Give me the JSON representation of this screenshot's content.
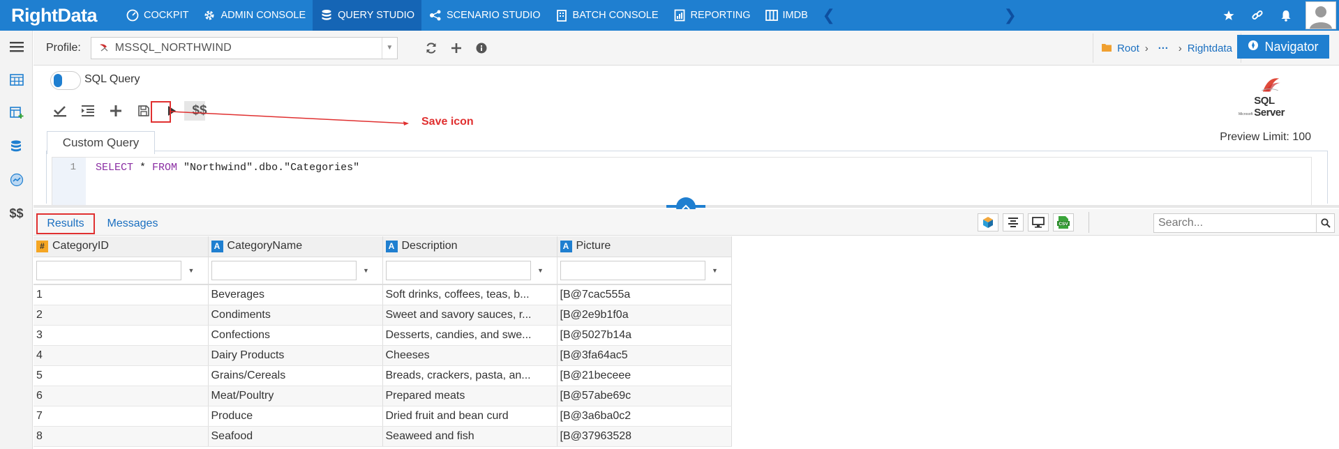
{
  "topbar": {
    "logo": "RightData",
    "nav": [
      {
        "label": "COCKPIT",
        "icon": "cockpit-gauge-icon"
      },
      {
        "label": "ADMIN CONSOLE",
        "icon": "gear-icon"
      },
      {
        "label": "QUERY STUDIO",
        "icon": "database-icon",
        "active": true
      },
      {
        "label": "SCENARIO STUDIO",
        "icon": "network-icon"
      },
      {
        "label": "BATCH CONSOLE",
        "icon": "building-icon"
      },
      {
        "label": "REPORTING",
        "icon": "report-chart-icon"
      },
      {
        "label": "IMDB",
        "icon": "columns-icon"
      }
    ],
    "right_icons": [
      "star-icon",
      "link-icon",
      "bell-icon",
      "user-avatar"
    ]
  },
  "sidebar": {
    "icons": [
      "menu-icon",
      "calendar-grid-icon",
      "table-add-icon",
      "database-connect-icon",
      "chart-circle-icon",
      "dollar-icon"
    ]
  },
  "profile": {
    "label": "Profile:",
    "value": "MSSQL_NORTHWIND",
    "buttons": [
      "refresh-icon",
      "add-icon",
      "info-icon"
    ]
  },
  "breadcrumb": {
    "root": "Root",
    "ellipsis": "···",
    "current": "Rightdata"
  },
  "navigator_label": "Navigator",
  "sql_toggle_label": "SQL Query",
  "toolbar": {
    "validate": "check-icon",
    "format": "indent-icon",
    "add": "plus-icon",
    "save": "save-icon",
    "run": "play-icon",
    "params": "$$"
  },
  "annotation": "Save icon",
  "engine_logo_text": "SQL Server",
  "engine_logo_small": "Microsoft",
  "preview_limit": "Preview Limit: 100",
  "query_tab": "Custom Query",
  "editor": {
    "line_no": "1",
    "kw1": "SELECT",
    "mid": " * ",
    "kw2": "FROM",
    "rest": " \"Northwind\".dbo.\"Categories\""
  },
  "results_tabs": {
    "results": "Results",
    "messages": "Messages"
  },
  "search_placeholder": "Search...",
  "grid": {
    "columns": [
      {
        "name": "CategoryID",
        "type": "#"
      },
      {
        "name": "CategoryName",
        "type": "A"
      },
      {
        "name": "Description",
        "type": "A"
      },
      {
        "name": "Picture",
        "type": "A"
      }
    ],
    "rows": [
      [
        "1",
        "Beverages",
        "Soft drinks, coffees, teas, b...",
        "[B@7cac555a"
      ],
      [
        "2",
        "Condiments",
        "Sweet and savory sauces, r...",
        "[B@2e9b1f0a"
      ],
      [
        "3",
        "Confections",
        "Desserts, candies, and swe...",
        "[B@5027b14a"
      ],
      [
        "4",
        "Dairy Products",
        "Cheeses",
        "[B@3fa64ac5"
      ],
      [
        "5",
        "Grains/Cereals",
        "Breads, crackers, pasta, an...",
        "[B@21beceee"
      ],
      [
        "6",
        "Meat/Poultry",
        "Prepared meats",
        "[B@57abe69c"
      ],
      [
        "7",
        "Produce",
        "Dried fruit and bean curd",
        "[B@3a6ba0c2"
      ],
      [
        "8",
        "Seafood",
        "Seaweed and fish",
        "[B@37963528"
      ]
    ]
  }
}
